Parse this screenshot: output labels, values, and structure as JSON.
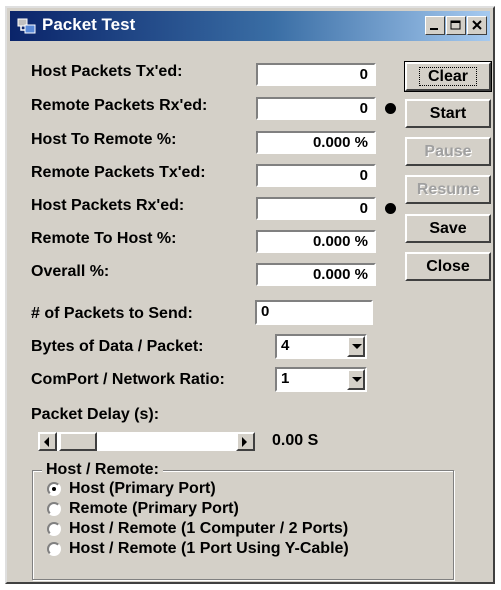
{
  "window": {
    "title": "Packet Test",
    "icon": "packet-app-icon"
  },
  "stats": {
    "host_tx_label": "Host Packets Tx'ed:",
    "host_tx_value": "0",
    "remote_rx_label": "Remote Packets Rx'ed:",
    "remote_rx_value": "0",
    "host_to_remote_label": "Host To Remote %:",
    "host_to_remote_value": "0.000 %",
    "remote_tx_label": "Remote Packets Tx'ed:",
    "remote_tx_value": "0",
    "host_rx_label": "Host Packets Rx'ed:",
    "host_rx_value": "0",
    "remote_to_host_label": "Remote To Host %:",
    "remote_to_host_value": "0.000 %",
    "overall_label": "Overall %:",
    "overall_value": "0.000 %"
  },
  "buttons": {
    "clear": "Clear",
    "start": "Start",
    "pause": "Pause",
    "resume": "Resume",
    "save": "Save",
    "close": "Close"
  },
  "settings": {
    "packets_to_send_label": "# of Packets to Send:",
    "packets_to_send_value": "0",
    "bytes_per_packet_label": "Bytes of Data / Packet:",
    "bytes_per_packet_value": "4",
    "ratio_label": "ComPort / Network Ratio:",
    "ratio_value": "1",
    "delay_label": "Packet Delay (s):",
    "delay_value": "0.00 S",
    "delay_slider_level": 0
  },
  "host_remote": {
    "title": "Host / Remote:",
    "options": [
      {
        "label": "Host (Primary Port)",
        "checked": true
      },
      {
        "label": "Remote (Primary Port)",
        "checked": false
      },
      {
        "label": "Host / Remote (1 Computer / 2 Ports)",
        "checked": false
      },
      {
        "label": "Host / Remote (1 Port Using Y-Cable)",
        "checked": false
      }
    ]
  },
  "colors": {
    "face": "#d4d0c8",
    "title_start": "#0a246a",
    "title_end": "#a6caf0",
    "disabled_text": "#a0a0a0"
  }
}
